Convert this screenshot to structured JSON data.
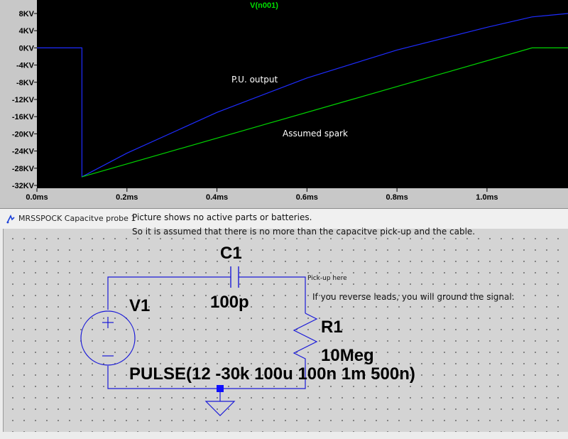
{
  "plot": {
    "trace_label": "V(n001)",
    "y_ticks": [
      "8KV",
      "4KV",
      "0KV",
      "-4KV",
      "-8KV",
      "-12KV",
      "-16KV",
      "-20KV",
      "-24KV",
      "-28KV",
      "-32KV"
    ],
    "x_ticks": [
      "0.0ms",
      "0.2ms",
      "0.4ms",
      "0.6ms",
      "0.8ms",
      "1.0ms"
    ],
    "annotation_pu": "P.U. output",
    "annotation_spark": "Assumed spark",
    "colors": {
      "background": "#000000",
      "trace_blue": "#1e2cff",
      "trace_green": "#00d400",
      "label_green": "#00e000"
    }
  },
  "chart_data": {
    "type": "line",
    "title": "V(n001)",
    "xlabel": "",
    "ylabel": "",
    "x_unit": "ms",
    "y_unit": "KV",
    "xlim": [
      0,
      1.18
    ],
    "ylim": [
      -32,
      8
    ],
    "grid": false,
    "series": [
      {
        "name": "P.U. output",
        "color": "#1e2cff",
        "points": [
          [
            0,
            0
          ],
          [
            0.1,
            0
          ],
          [
            0.1,
            -30
          ],
          [
            0.2,
            -24.5
          ],
          [
            0.4,
            -15
          ],
          [
            0.6,
            -7
          ],
          [
            0.8,
            -0.5
          ],
          [
            1.0,
            4.8
          ],
          [
            1.1,
            7.2
          ],
          [
            1.18,
            8
          ]
        ]
      },
      {
        "name": "Assumed spark",
        "color": "#00d400",
        "points": [
          [
            0.1,
            -30
          ],
          [
            0.3,
            -24
          ],
          [
            0.5,
            -18
          ],
          [
            0.7,
            -12
          ],
          [
            0.9,
            -6
          ],
          [
            1.1,
            0
          ],
          [
            1.18,
            0
          ]
        ]
      }
    ]
  },
  "schematic": {
    "window_title": "MRSSPOCK Capacitve probe 1",
    "note_line1": "Picture shows no active parts or batteries.",
    "note_line2": "So it is assumed that there is no more than the capacitve pick-up and the cable.",
    "c1_name": "C1",
    "c1_value": "100p",
    "v1_name": "V1",
    "v1_value": "PULSE(12 -30k 100u 100n 1m 500n)",
    "r1_name": "R1",
    "r1_value": "10Meg",
    "pickup_label": "Pick-up here",
    "reverse_note": "If you reverse leads, you will ground the signal.",
    "colors": {
      "wire": "#1a1ad8",
      "symbol": "#1a1ad8",
      "node": "#1010ff"
    }
  }
}
